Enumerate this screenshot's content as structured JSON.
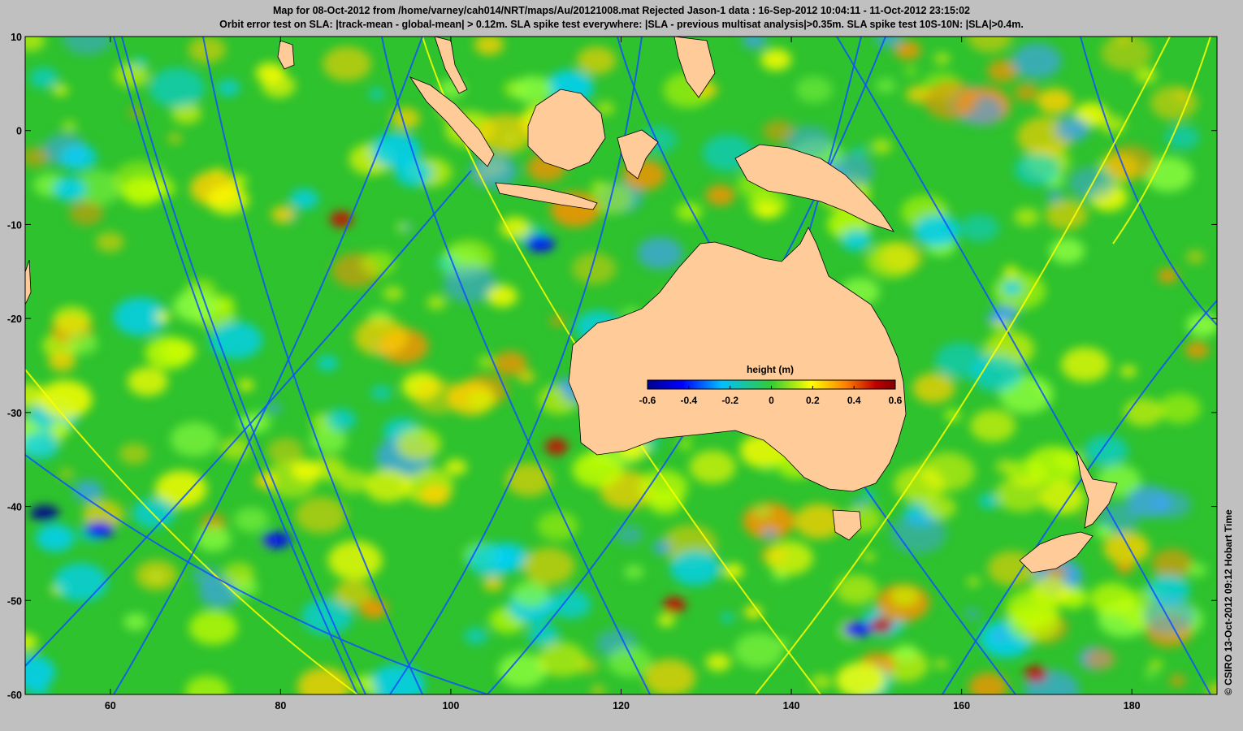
{
  "header": {
    "title_line1": "Map for 08-Oct-2012 from /home/varney/cah014/NRT/maps/Au/20121008.mat  Rejected Jason-1 data : 16-Sep-2012 10:04:11 - 11-Oct-2012 23:15:02",
    "title_line2": "Orbit error test on SLA: |track-mean  - global-mean| > 0.12m.  SLA spike test everywhere: |SLA - previous multisat analysis|>0.35m. SLA spike test 10S-10N: |SLA|>0.4m."
  },
  "map": {
    "lon_range": [
      50,
      190
    ],
    "lat_range": [
      -60,
      10
    ],
    "x_ticks": [
      "60",
      "80",
      "100",
      "120",
      "140",
      "160",
      "180"
    ],
    "x_tick_values": [
      60,
      80,
      100,
      120,
      140,
      160,
      180
    ],
    "y_ticks": [
      "10",
      "0",
      "-10",
      "-20",
      "-30",
      "-40",
      "-50",
      "-60"
    ],
    "y_tick_values": [
      10,
      0,
      -10,
      -20,
      -30,
      -40,
      -50,
      -60
    ],
    "ocean_color": "#2ec22e",
    "land_color": "#ffcc99"
  },
  "colorbar": {
    "title": "height (m)",
    "ticks": [
      "-0.6",
      "-0.4",
      "-0.2",
      "0",
      "0.2",
      "0.4",
      "0.6"
    ],
    "tick_values": [
      -0.6,
      -0.4,
      -0.2,
      0,
      0.2,
      0.4,
      0.6
    ],
    "colors": [
      "#00008f",
      "#0000ff",
      "#00bfff",
      "#32cd32",
      "#ffff00",
      "#ff8000",
      "#c00000",
      "#800000"
    ]
  },
  "credit": "© CSIRO 13-Oct-2012 09:12 Hobart Time"
}
